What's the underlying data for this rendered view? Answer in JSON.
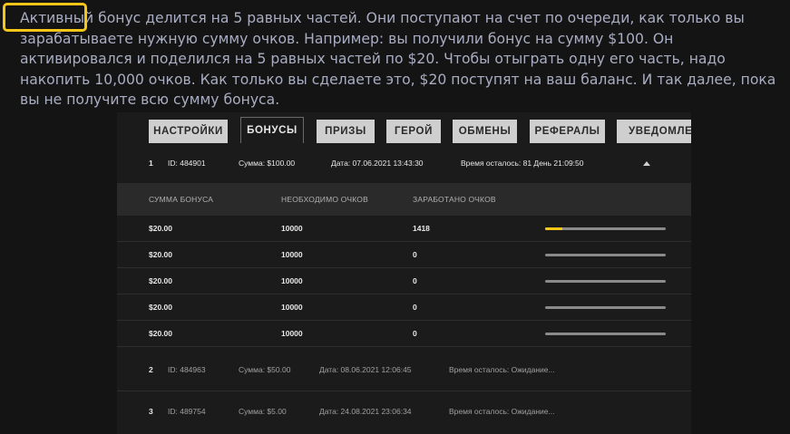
{
  "intro": {
    "highlight": "Активный",
    "rest": " бонус делится на 5 равных частей. Они поступают на счет по очереди, как только вы зарабатываете нужную сумму очков. Например: вы получили бонус на сумму $100. Он активировался и поделился на 5 равных частей по $20. Чтобы отыграть одну его часть, надо накопить 10,000 очков. Как только вы сделаете это, $20 поступят на ваш баланс. И так далее, пока вы не получите всю сумму бонуса."
  },
  "tabs": [
    {
      "label": "НАСТРОЙКИ",
      "active": false
    },
    {
      "label": "БОНУСЫ",
      "active": true
    },
    {
      "label": "ПРИЗЫ",
      "active": false
    },
    {
      "label": "ГЕРОЙ",
      "active": false
    },
    {
      "label": "ОБМЕНЫ",
      "active": false
    },
    {
      "label": "РЕФЕРАЛЫ",
      "active": false
    },
    {
      "label": "УВЕДОМЛЕНИЯ",
      "active": false
    }
  ],
  "bonuses": [
    {
      "num": "1",
      "id": "ID: 484901",
      "amount": "Сумма: $100.00",
      "date": "Дата: 07.06.2021 13:43:30",
      "time_left": "Время осталось: 81 День 21:09:50",
      "expanded": true
    },
    {
      "num": "2",
      "id": "ID: 484963",
      "amount": "Сумма: $50.00",
      "date": "Дата: 08.06.2021 12:06:45",
      "time_left": "Время осталось: Ожидание...",
      "expanded": false
    },
    {
      "num": "3",
      "id": "ID: 489754",
      "amount": "Сумма: $5.00",
      "date": "Дата: 24.08.2021 23:06:34",
      "time_left": "Время осталось: Ожидание...",
      "expanded": false
    }
  ],
  "detail": {
    "headers": [
      "СУММА БОНУСА",
      "НЕОБХОДИМО ОЧКОВ",
      "ЗАРАБОТАНО ОЧКОВ"
    ],
    "rows": [
      {
        "amount": "$20.00",
        "required": "10000",
        "earned": "1418",
        "progress": 0.1418
      },
      {
        "amount": "$20.00",
        "required": "10000",
        "earned": "0",
        "progress": 0
      },
      {
        "amount": "$20.00",
        "required": "10000",
        "earned": "0",
        "progress": 0
      },
      {
        "amount": "$20.00",
        "required": "10000",
        "earned": "0",
        "progress": 0
      },
      {
        "amount": "$20.00",
        "required": "10000",
        "earned": "0",
        "progress": 0
      }
    ]
  },
  "colors": {
    "accent": "#f5c518",
    "background": "#141414",
    "panel": "#1b1b1b"
  }
}
